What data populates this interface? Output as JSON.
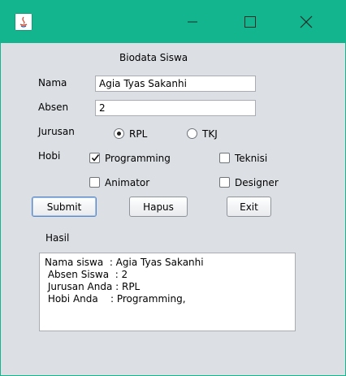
{
  "window": {
    "minimize_symbol": "—",
    "maximize_symbol": "☐",
    "close_symbol": "✕"
  },
  "form": {
    "title": "Biodata Siswa",
    "nama_label": "Nama",
    "nama_value": "Agia Tyas Sakanhi",
    "absen_label": "Absen",
    "absen_value": "2",
    "jurusan_label": "Jurusan",
    "jurusan_options": [
      {
        "label": "RPL",
        "selected": true
      },
      {
        "label": "TKJ",
        "selected": false
      }
    ],
    "hobi_label": "Hobi",
    "hobi_options": [
      {
        "label": "Programming",
        "checked": true
      },
      {
        "label": "Teknisi",
        "checked": false
      },
      {
        "label": "Animator",
        "checked": false
      },
      {
        "label": "Designer",
        "checked": false
      }
    ]
  },
  "buttons": {
    "submit": "Submit",
    "hapus": "Hapus",
    "exit": "Exit"
  },
  "result": {
    "label": "Hasil",
    "lines": [
      "Nama siswa  : Agia Tyas Sakanhi",
      " Absen Siswa  : 2",
      " Jurusan Anda : RPL",
      " Hobi Anda    : Programming,"
    ]
  },
  "colors": {
    "titlebar": "#12b58e",
    "window_bg": "#dcdfe4"
  }
}
